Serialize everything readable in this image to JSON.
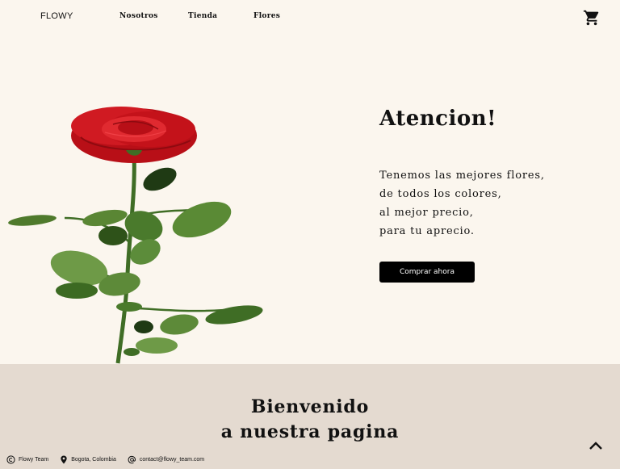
{
  "header": {
    "logo": "FLOWY",
    "nav": [
      "Nosotros",
      "Tienda",
      "Flores"
    ],
    "cart_icon": "shopping-cart-icon"
  },
  "hero": {
    "title": "Atencion!",
    "lines": [
      "Tenemos las mejores flores,",
      "de todos los colores,",
      "al mejor precio,",
      "para tu aprecio."
    ],
    "button": "Comprar ahora",
    "image": "red-rose"
  },
  "welcome": {
    "title_line1": "Bienvenido",
    "title_line2": "a nuestra pagina"
  },
  "footer": {
    "team": "Flowy Team",
    "location": "Bogota, Colombia",
    "email": "contact@flowy_team.com"
  },
  "colors": {
    "background": "#fbf6ee",
    "section": "#e4dad0",
    "rose": "#c4121a",
    "leaf": "#4f7a2c",
    "button": "#000000"
  }
}
